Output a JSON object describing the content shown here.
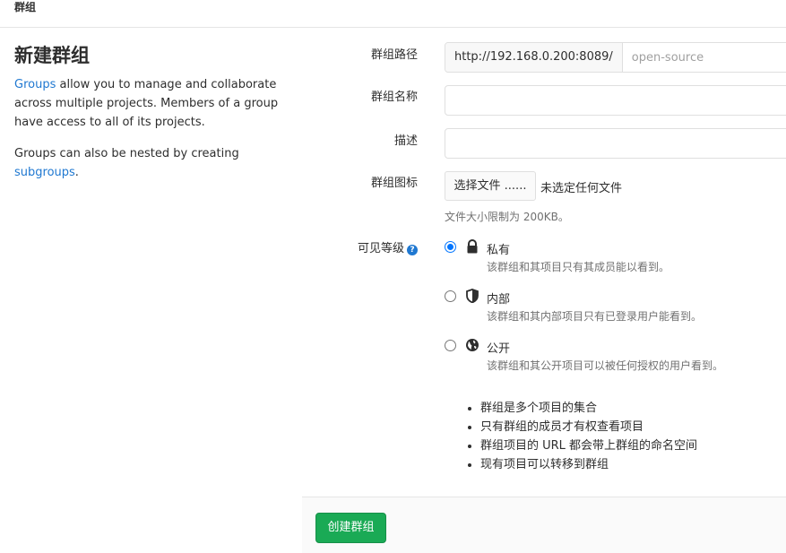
{
  "breadcrumb": "群组",
  "page_title": "新建群组",
  "intro": {
    "link1": "Groups",
    "text1": " allow you to manage and collaborate across multiple projects. Members of a group have access to all of its projects.",
    "text2": "Groups can also be nested by creating ",
    "link2": "subgroups",
    "text2_end": "."
  },
  "form": {
    "path_label": "群组路径",
    "path_prefix": "http://192.168.0.200:8089/",
    "path_placeholder": "open-source",
    "name_label": "群组名称",
    "desc_label": "描述",
    "avatar_label": "群组图标",
    "file_button": "选择文件 ......",
    "file_status": "未选定任何文件",
    "file_hint": "文件大小限制为 200KB。",
    "visibility_label": "可见等级",
    "help_glyph": "?"
  },
  "visibility": [
    {
      "title": "私有",
      "desc": "该群组和其项目只有其成员能以看到。",
      "icon": "lock-icon",
      "checked": true
    },
    {
      "title": "内部",
      "desc": "该群组和其内部项目只有已登录用户能看到。",
      "icon": "shield-icon",
      "checked": false
    },
    {
      "title": "公开",
      "desc": "该群组和其公开项目可以被任何授权的用户看到。",
      "icon": "globe-icon",
      "checked": false
    }
  ],
  "bullets": [
    "群组是多个项目的集合",
    "只有群组的成员才有权查看项目",
    "群组项目的 URL 都会带上群组的命名空间",
    "现有项目可以转移到群组"
  ],
  "create_button": "创建群组",
  "colors": {
    "accent": "#1f78d1",
    "success": "#1aaa55"
  }
}
